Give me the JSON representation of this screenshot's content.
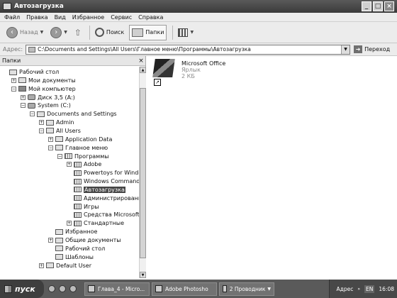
{
  "window": {
    "title": "Автозагрузка"
  },
  "menu": [
    "Файл",
    "Правка",
    "Вид",
    "Избранное",
    "Сервис",
    "Справка"
  ],
  "toolbar": {
    "back": "Назад",
    "search": "Поиск",
    "folders": "Папки"
  },
  "address": {
    "label": "Адрес:",
    "path": "C:\\Documents and Settings\\All Users\\Главное меню\\Программы\\Автозагрузка",
    "go": "Переход"
  },
  "folders_pane": {
    "title": "Папки",
    "tree": [
      {
        "label": "Рабочий стол",
        "level": 0,
        "expander": "",
        "icon": "desktop-icon"
      },
      {
        "label": "Мои документы",
        "level": 1,
        "expander": "+",
        "icon": "folder-icon"
      },
      {
        "label": "Мой компьютер",
        "level": 1,
        "expander": "−",
        "icon": "computer-icon"
      },
      {
        "label": "Диск 3,5 (A:)",
        "level": 2,
        "expander": "+",
        "icon": "drive-icon"
      },
      {
        "label": "System (C:)",
        "level": 2,
        "expander": "−",
        "icon": "drive-icon"
      },
      {
        "label": "Documents and Settings",
        "level": 3,
        "expander": "−",
        "icon": "folder-icon"
      },
      {
        "label": "Admin",
        "level": 4,
        "expander": "+",
        "icon": "folder-icon"
      },
      {
        "label": "All Users",
        "level": 4,
        "expander": "−",
        "icon": "folder-icon"
      },
      {
        "label": "Application Data",
        "level": 5,
        "expander": "+",
        "icon": "folder-icon"
      },
      {
        "label": "Главное меню",
        "level": 5,
        "expander": "−",
        "icon": "folder-icon"
      },
      {
        "label": "Программы",
        "level": 6,
        "expander": "−",
        "icon": "program-folder-icon"
      },
      {
        "label": "Adobe",
        "level": 7,
        "expander": "+",
        "icon": "program-folder-icon"
      },
      {
        "label": "Powertoys for Windows X",
        "level": 7,
        "expander": "",
        "icon": "program-folder-icon"
      },
      {
        "label": "Windows Commander",
        "level": 7,
        "expander": "",
        "icon": "program-folder-icon"
      },
      {
        "label": "Автозагрузка",
        "level": 7,
        "expander": "",
        "icon": "program-folder-icon",
        "selected": true
      },
      {
        "label": "Администрирование",
        "level": 7,
        "expander": "",
        "icon": "program-folder-icon"
      },
      {
        "label": "Игры",
        "level": 7,
        "expander": "",
        "icon": "program-folder-icon"
      },
      {
        "label": "Средства Microsoft Offic",
        "level": 7,
        "expander": "",
        "icon": "program-folder-icon"
      },
      {
        "label": "Стандартные",
        "level": 7,
        "expander": "+",
        "icon": "program-folder-icon"
      },
      {
        "label": "Избранное",
        "level": 5,
        "expander": "",
        "icon": "folder-icon"
      },
      {
        "label": "Общие документы",
        "level": 5,
        "expander": "+",
        "icon": "folder-icon"
      },
      {
        "label": "Рабочий стол",
        "level": 5,
        "expander": "",
        "icon": "folder-icon"
      },
      {
        "label": "Шаблоны",
        "level": 5,
        "expander": "",
        "icon": "folder-icon"
      },
      {
        "label": "Default User",
        "level": 4,
        "expander": "+",
        "icon": "folder-icon"
      }
    ]
  },
  "content": {
    "items": [
      {
        "name": "Microsoft Office",
        "type": "Ярлык",
        "size": "2 КБ",
        "icon": "office-shortcut-icon"
      }
    ]
  },
  "taskbar": {
    "start": "пуск",
    "tasks": [
      {
        "label": "Глава_4 - Micro...",
        "icon": "word-icon"
      },
      {
        "label": "Adobe Photosho",
        "icon": "photoshop-icon"
      },
      {
        "label": "2 Проводник",
        "icon": "explorer-icon"
      }
    ],
    "tray_address": "Адрес",
    "lang": "EN",
    "clock": "16:08"
  }
}
